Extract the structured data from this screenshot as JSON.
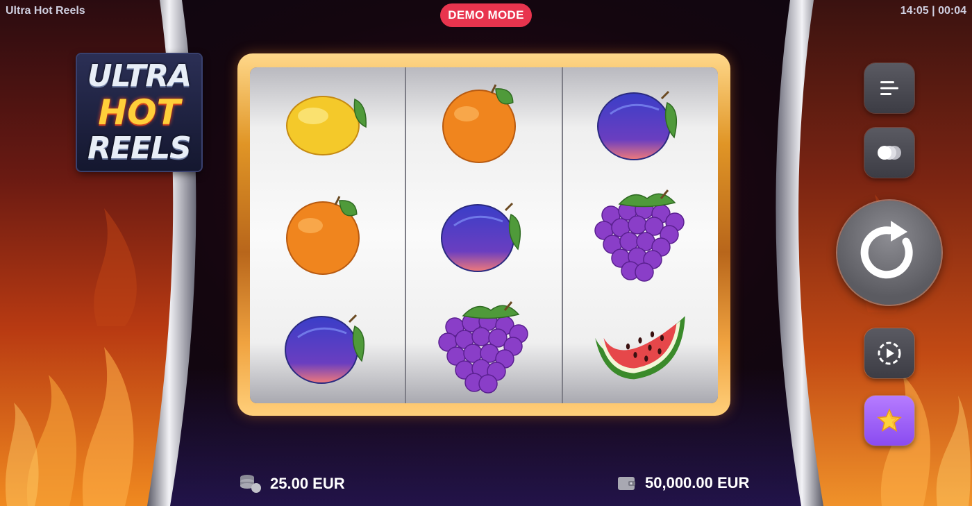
{
  "header": {
    "game_title": "Ultra Hot Reels",
    "clock": "14:05 | 00:04",
    "demo_badge": "DEMO MODE"
  },
  "logo": {
    "line1": "ULTRA",
    "line2": "HOT",
    "line3": "REELS"
  },
  "reels": [
    [
      "lemon",
      "orange",
      "plum"
    ],
    [
      "orange",
      "plum",
      "grapes"
    ],
    [
      "plum",
      "grapes",
      "watermelon"
    ]
  ],
  "controls": {
    "menu": "menu-icon",
    "bet": "coins-icon",
    "spin": "spin-icon",
    "autoplay": "autoplay-icon",
    "favorite": "star-icon"
  },
  "footer": {
    "bet": "25.00 EUR",
    "balance": "50,000.00 EUR"
  },
  "colors": {
    "demo_badge": "#e8344e",
    "frame_gold": "#e09526",
    "favorite_button": "#9a5cf5"
  }
}
